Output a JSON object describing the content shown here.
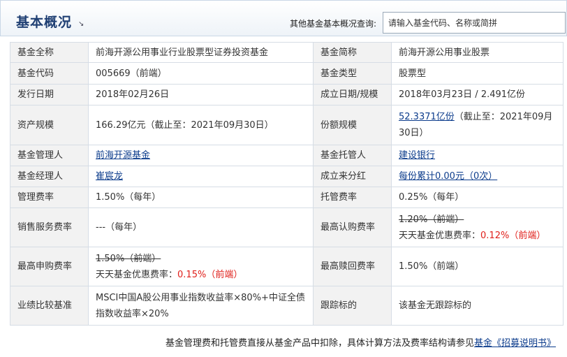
{
  "header": {
    "title": "基本概况",
    "title_icon": "↘",
    "search_label": "其他基金基本概况查询:",
    "search_placeholder": "请输入基金代码、名称或简拼"
  },
  "rows": [
    {
      "l1": "基金全称",
      "v1": "前海开源公用事业行业股票型证券投资基金",
      "l2": "基金简称",
      "v2": "前海开源公用事业股票"
    },
    {
      "l1": "基金代码",
      "v1": "005669（前端）",
      "l2": "基金类型",
      "v2": "股票型"
    },
    {
      "l1": "发行日期",
      "v1": "2018年02月26日",
      "l2": "成立日期/规模",
      "v2": "2018年03月23日 / 2.491亿份"
    },
    {
      "l1": "资产规模",
      "v1": "166.29亿元（截止至：2021年09月30日）",
      "l2": "份额规模",
      "v2_link": "52.3371亿份",
      "v2": "（截止至：2021年09月30日）"
    },
    {
      "l1": "基金管理人",
      "v1_link": "前海开源基金",
      "l2": "基金托管人",
      "v2_link": "建设银行"
    },
    {
      "l1": "基金经理人",
      "v1_link": "崔宸龙",
      "l2": "成立来分红",
      "v2_link": "每份累计0.00元（0次）"
    },
    {
      "l1": "管理费率",
      "v1": "1.50%（每年）",
      "l2": "托管费率",
      "v2": "0.25%（每年）"
    },
    {
      "l1": "销售服务费率",
      "v1": "---（每年）",
      "l2": "最高认购费率",
      "v2_strike": "1.20%（前端）",
      "v2_prefix": "天天基金优惠费率：",
      "v2_red": "0.12%（前端）"
    },
    {
      "l1": "最高申购费率",
      "v1_strike": "1.50%（前端）",
      "v1_prefix": "天天基金优惠费率：",
      "v1_red": "0.15%（前端）",
      "l2": "最高赎回费率",
      "v2": "1.50%（前端）"
    },
    {
      "l1": "业绩比较基准",
      "v1": "MSCI中国A股公用事业指数收益率×80%+中证全债指数收益率×20%",
      "l2": "跟踪标的",
      "v2": "该基金无跟踪标的"
    }
  ],
  "footer": {
    "text": "基金管理费和托管费直接从基金产品中扣除，具体计算方法及费率结构请参见",
    "link": "基金《招募说明书》"
  }
}
